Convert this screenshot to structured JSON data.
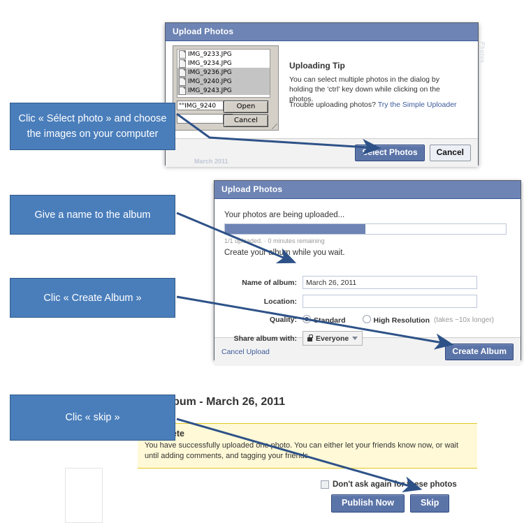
{
  "dialog_select": {
    "title": "Upload Photos",
    "file_chooser": {
      "files": [
        {
          "name": "IMG_9233.JPG",
          "selected": false
        },
        {
          "name": "IMG_9234.JPG",
          "selected": false
        },
        {
          "name": "IMG_9236.JPG",
          "selected": true
        },
        {
          "name": "IMG_9240.JPG",
          "selected": true
        },
        {
          "name": "IMG_9243.JPG",
          "selected": true
        }
      ],
      "filename_value": "\"\"IMG_9240",
      "filetype_value": "",
      "open_label": "Open",
      "cancel_label": "Cancel"
    },
    "tip_title": "Uploading Tip",
    "tip_text": "You can select multiple photos in the dialog by holding the 'ctrl' key down while clicking on the photos.",
    "trouble_text": "Trouble uploading photos?",
    "trouble_link": "Try the Simple Uploader",
    "select_photos_label": "Select Photos",
    "cancel_label": "Cancel"
  },
  "dialog_upload": {
    "title": "Upload Photos",
    "heading": "Your photos are being uploaded...",
    "progress_percent": 50,
    "progress_label": "1/1 uploaded. · 0 minutes remaining",
    "subheading": "Create your album while you wait.",
    "fields": {
      "album_label": "Name of album:",
      "album_value": "March 26, 2011",
      "location_label": "Location:",
      "location_value": "",
      "quality_label": "Quality:",
      "quality_standard": "Standard",
      "quality_high": "High Resolution",
      "quality_note": "(takes ~10x longer)",
      "quality_selected": "Standard",
      "share_label": "Share album with:",
      "share_value": "Everyone"
    },
    "cancel_upload_label": "Cancel Upload",
    "create_album_label": "Create Album"
  },
  "edit_album": {
    "page_title": "Edit Album - March 26, 2011",
    "notice_title": "Complete",
    "notice_text": "You have successfully uploaded one photo. You can either let your friends know now, or wait until adding comments, and tagging your friends.",
    "checkbox_label": "Don't ask again for these photos",
    "publish_label": "Publish Now",
    "skip_label": "Skip"
  },
  "callouts": [
    {
      "id": "select-photo",
      "text": "Clic « Sélect photo » and choose the images on your computer"
    },
    {
      "id": "album-name",
      "text": "Give a name to the album"
    },
    {
      "id": "create-album",
      "text": "Clic « Create Album »"
    },
    {
      "id": "skip",
      "text": "Clic « skip »"
    }
  ],
  "colors": {
    "callout_fill": "#4a7ebb",
    "callout_border": "#315b8c",
    "titlebar": "#6d84b4",
    "primary_button": "#5b74a8",
    "notice_bg": "#fff9d7",
    "arrow": "#2e5288"
  },
  "ghost": {
    "label_1": "March 2011",
    "label_2": "Photos"
  }
}
